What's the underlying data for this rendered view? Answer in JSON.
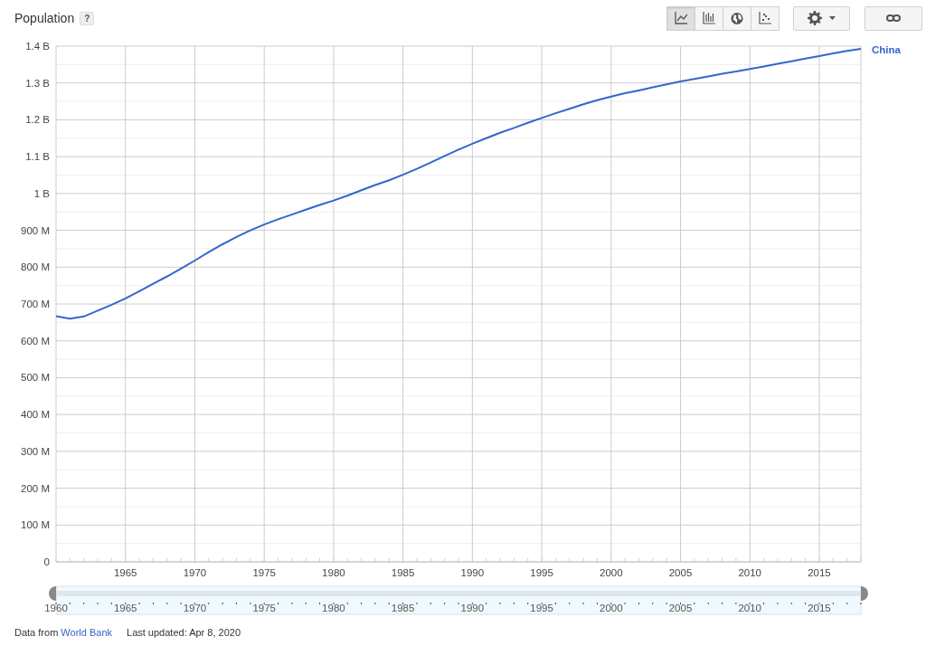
{
  "header": {
    "title": "Population",
    "help": "?"
  },
  "toolbar": {
    "chart_types": [
      {
        "kind": "line",
        "selected": true
      },
      {
        "kind": "bar",
        "selected": false
      },
      {
        "kind": "map",
        "selected": false
      },
      {
        "kind": "scatter",
        "selected": false
      }
    ]
  },
  "chart": {
    "chart_data": {
      "type": "line",
      "x": [
        1960,
        1961,
        1962,
        1963,
        1964,
        1965,
        1966,
        1967,
        1968,
        1969,
        1970,
        1971,
        1972,
        1973,
        1974,
        1975,
        1976,
        1977,
        1978,
        1979,
        1980,
        1981,
        1982,
        1983,
        1984,
        1985,
        1986,
        1987,
        1988,
        1989,
        1990,
        1991,
        1992,
        1993,
        1994,
        1995,
        1996,
        1997,
        1998,
        1999,
        2000,
        2001,
        2002,
        2003,
        2004,
        2005,
        2006,
        2007,
        2008,
        2009,
        2010,
        2011,
        2012,
        2013,
        2014,
        2015,
        2016,
        2017,
        2018
      ],
      "series": [
        {
          "name": "China",
          "color": "#3366cc",
          "values": [
            667000000,
            660000000,
            666000000,
            682000000,
            698000000,
            715000000,
            735000000,
            755000000,
            775000000,
            796000000,
            818000000,
            841000000,
            862000000,
            882000000,
            900000000,
            916000000,
            930000000,
            943000000,
            956000000,
            969000000,
            981000000,
            994000000,
            1009000000,
            1023000000,
            1036000000,
            1051000000,
            1067000000,
            1084000000,
            1102000000,
            1119000000,
            1135000000,
            1150000000,
            1165000000,
            1178000000,
            1192000000,
            1205000000,
            1218000000,
            1230000000,
            1242000000,
            1253000000,
            1263000000,
            1272000000,
            1280000000,
            1288000000,
            1296000000,
            1304000000,
            1311000000,
            1318000000,
            1325000000,
            1331000000,
            1338000000,
            1345000000,
            1352000000,
            1359000000,
            1366000000,
            1373000000,
            1380000000,
            1387000000,
            1393000000
          ]
        }
      ],
      "xlim": [
        1960,
        2018
      ],
      "ylim": [
        0,
        1400000000
      ],
      "grid": true,
      "xticks": [
        1965,
        1970,
        1975,
        1980,
        1985,
        1990,
        1995,
        2000,
        2005,
        2010,
        2015
      ],
      "yticks": [
        {
          "value": 0,
          "label": "0"
        },
        {
          "value": 100000000,
          "label": "100 M"
        },
        {
          "value": 200000000,
          "label": "200 M"
        },
        {
          "value": 300000000,
          "label": "300 M"
        },
        {
          "value": 400000000,
          "label": "400 M"
        },
        {
          "value": 500000000,
          "label": "500 M"
        },
        {
          "value": 600000000,
          "label": "600 M"
        },
        {
          "value": 700000000,
          "label": "700 M"
        },
        {
          "value": 800000000,
          "label": "800 M"
        },
        {
          "value": 900000000,
          "label": "900 M"
        },
        {
          "value": 1000000000,
          "label": "1 B"
        },
        {
          "value": 1100000000,
          "label": "1.1 B"
        },
        {
          "value": 1200000000,
          "label": "1.2 B"
        },
        {
          "value": 1300000000,
          "label": "1.3 B"
        },
        {
          "value": 1400000000,
          "label": "1.4 B"
        }
      ]
    }
  },
  "range_slider": {
    "labels": [
      "1960",
      "1965",
      "1970",
      "1975",
      "1980",
      "1985",
      "1990",
      "1995",
      "2000",
      "2005",
      "2010",
      "2015"
    ],
    "handles": [
      {
        "level": 0
      },
      {
        "level": 1
      }
    ]
  },
  "footer": {
    "source_prefix": "Data from",
    "source_link": "World Bank",
    "updated": "Last updated: Apr 8, 2020"
  }
}
